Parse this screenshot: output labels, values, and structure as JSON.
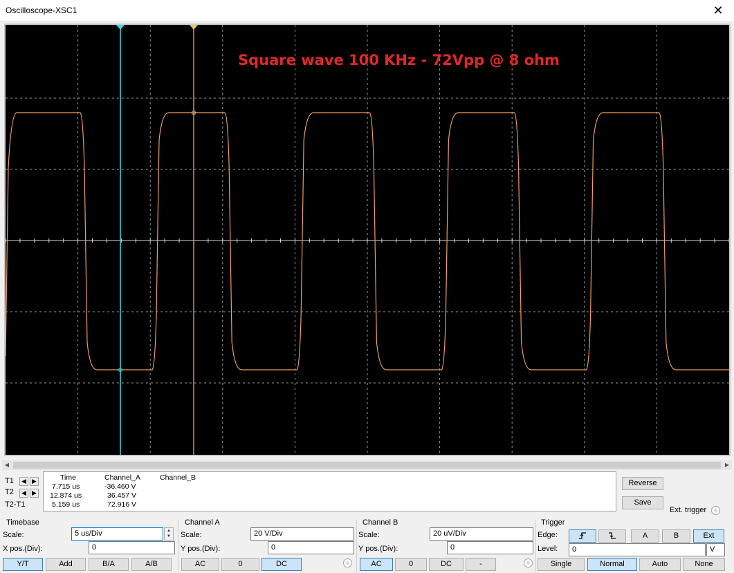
{
  "window": {
    "title": "Oscilloscope-XSC1",
    "close_glyph": "✕"
  },
  "screen": {
    "annotation": "Square wave 100 KHz - 72Vpp @ 8 ohm",
    "colors": {
      "background": "#000000",
      "grid": "#9a9a9a",
      "trace": "#f0a060",
      "cursor1": "#40d8e0",
      "cursor2": "#f0c060",
      "annotation": "#e02828"
    }
  },
  "cursors": {
    "t1_label": "T1",
    "t2_label": "T2",
    "diff_label": "T2-T1",
    "headers": {
      "time": "Time",
      "channel_a": "Channel_A",
      "channel_b": "Channel_B"
    },
    "rows": [
      {
        "time": "7.715 us",
        "a": "-36.460 V"
      },
      {
        "time": "12.874 us",
        "a": "36.457 V"
      },
      {
        "time": "5.159 us",
        "a": "72.916 V"
      }
    ]
  },
  "buttons": {
    "reverse": "Reverse",
    "save": "Save",
    "ext_trigger": "Ext. trigger"
  },
  "timebase": {
    "title": "Timebase",
    "scale_label": "Scale:",
    "scale_value": "5 us/Div",
    "xpos_label": "X pos.(Div):",
    "xpos_value": "0",
    "modes": [
      "Y/T",
      "Add",
      "B/A",
      "A/B"
    ]
  },
  "channel_a": {
    "title": "Channel A",
    "scale_label": "Scale:",
    "scale_value": "20  V/Div",
    "ypos_label": "Y pos.(Div):",
    "ypos_value": "0",
    "coupling": [
      "AC",
      "0",
      "DC"
    ]
  },
  "channel_b": {
    "title": "Channel B",
    "scale_label": "Scale:",
    "scale_value": "20 uV/Div",
    "ypos_label": "Y pos.(Div):",
    "ypos_value": "0",
    "coupling": [
      "AC",
      "0",
      "DC",
      "-"
    ]
  },
  "trigger": {
    "title": "Trigger",
    "edge_label": "Edge:",
    "edge_buttons": [
      "A",
      "B",
      "Ext"
    ],
    "level_label": "Level:",
    "level_value": "0",
    "level_unit": "V",
    "modes": [
      "Single",
      "Normal",
      "Auto",
      "None"
    ]
  }
}
